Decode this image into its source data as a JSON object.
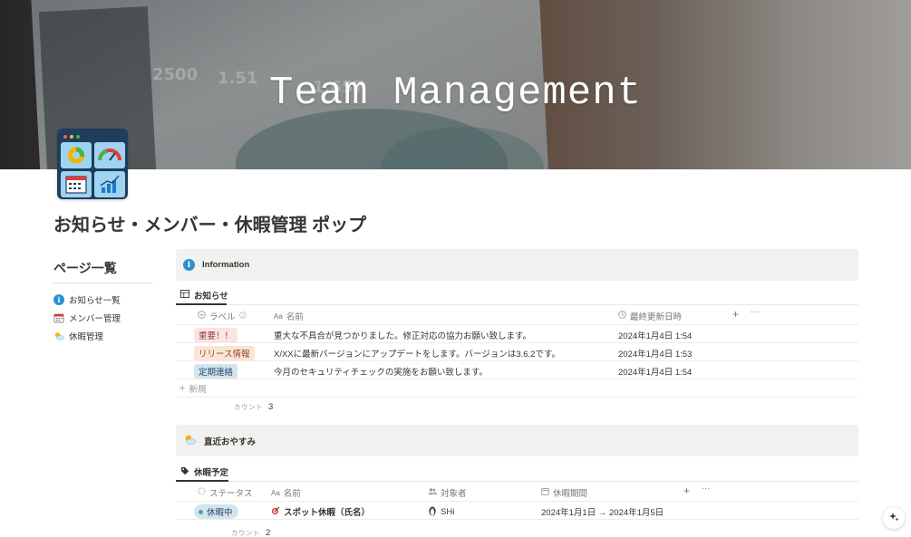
{
  "cover": {
    "title": "Team Management",
    "bg_numbers": [
      "2500",
      "1.51",
      "1.657"
    ]
  },
  "page": {
    "title": "お知らせ・メンバー・休暇管理 ポップ"
  },
  "nav": {
    "heading": "ページ一覧",
    "items": [
      {
        "label": "お知らせ一覧",
        "icon": "info-icon"
      },
      {
        "label": "メンバー管理",
        "icon": "calendar-icon"
      },
      {
        "label": "休暇管理",
        "icon": "sun-cloud-icon"
      }
    ]
  },
  "info_section": {
    "callout_title": "Information",
    "view_tab": "お知らせ",
    "columns": {
      "label": "ラベル",
      "name": "名前",
      "updated": "最終更新日時"
    },
    "rows": [
      {
        "label": "重要！！",
        "label_color": "red",
        "name": "重大な不具合が見つかりました。修正対応の協力お願い致します。",
        "updated": "2024年1月4日 1:54"
      },
      {
        "label": "リリース情報",
        "label_color": "orange",
        "name": "X/XXに最新バージョンにアップデートをします。バージョンは3.6.2です。",
        "updated": "2024年1月4日 1:53"
      },
      {
        "label": "定期連絡",
        "label_color": "blue",
        "name": "今月のセキュリティチェックの実施をお願い致します。",
        "updated": "2024年1月4日 1:54"
      }
    ],
    "new_label": "新規",
    "count_label": "カウント",
    "count_value": "3"
  },
  "vacation_section": {
    "callout_title": "直近おやすみ",
    "view_tab": "休暇予定",
    "columns": {
      "status": "ステータス",
      "name": "名前",
      "person": "対象者",
      "period": "休暇期間"
    },
    "rows": [
      {
        "status": "休暇中",
        "name": "スポット休暇（氏名）",
        "person": "SHi",
        "period": "2024年1月1日 → 2024年1月5日"
      }
    ],
    "count_label": "カウント",
    "count_value": "2"
  },
  "colors": {
    "accent_blue": "#2e8fd6",
    "tag_red_bg": "#fbe4e4",
    "tag_orange_bg": "#fae4d6",
    "tag_blue_bg": "#d3e5ef",
    "callout_bg": "#f1f1ef"
  }
}
